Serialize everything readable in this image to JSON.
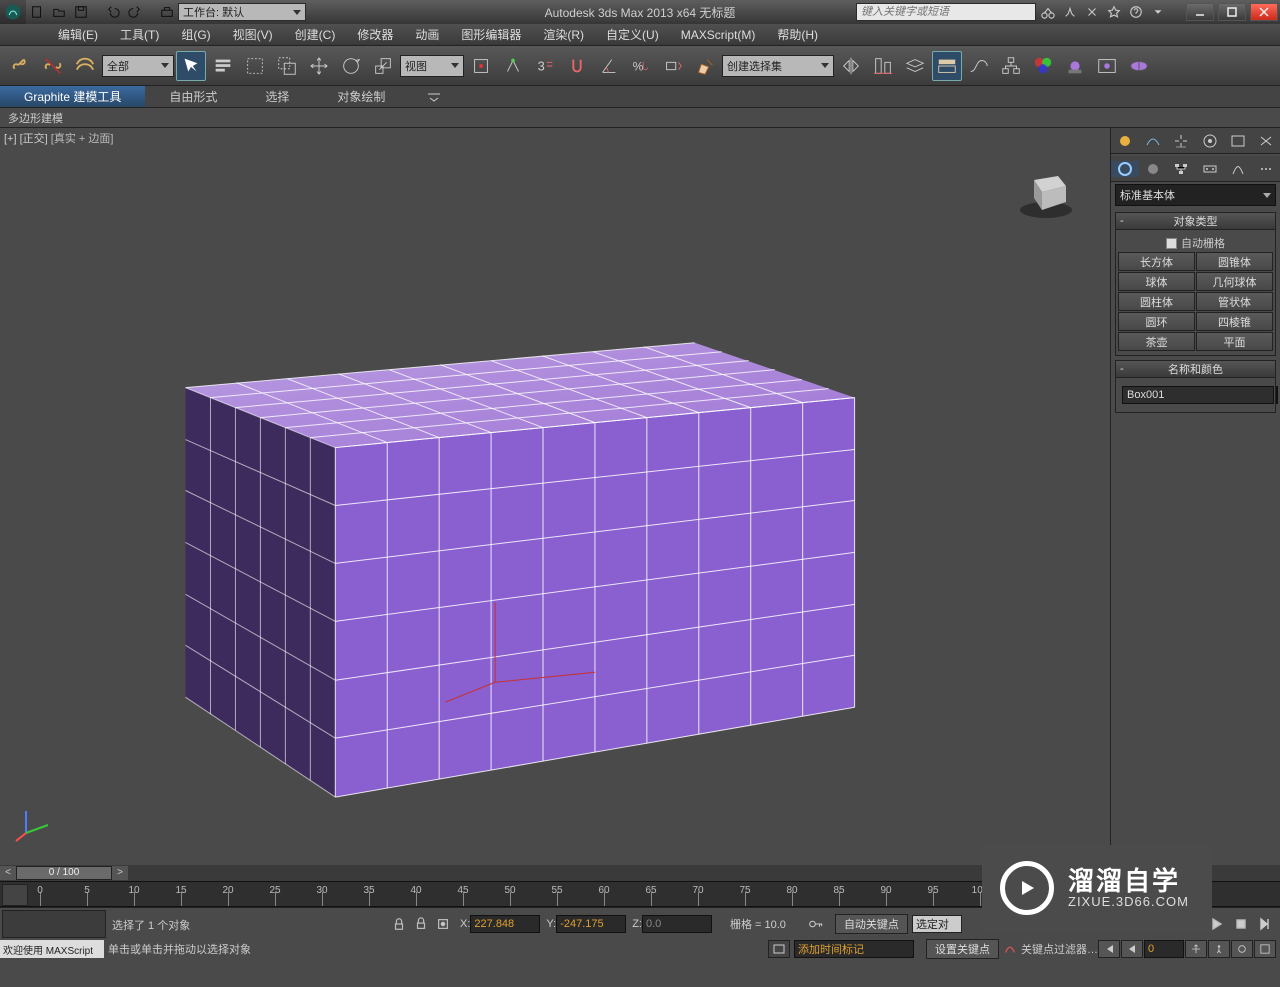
{
  "app": {
    "title": "Autodesk 3ds Max  2013 x64     无标题",
    "search_placeholder": "键入关键字或短语",
    "workspace": "工作台: 默认"
  },
  "menus": [
    "编辑(E)",
    "工具(T)",
    "组(G)",
    "视图(V)",
    "创建(C)",
    "修改器",
    "动画",
    "图形编辑器",
    "渲染(R)",
    "自定义(U)",
    "MAXScript(M)",
    "帮助(H)"
  ],
  "maintoolbar": {
    "filter": "全部",
    "view_combo": "视图",
    "named_set": "创建选择集"
  },
  "ribbon": {
    "tabs": [
      "Graphite 建模工具",
      "自由形式",
      "选择",
      "对象绘制"
    ],
    "subtab": "多边形建模"
  },
  "viewport": {
    "label_bracket1": "[+]",
    "label_bracket2": "[正交]",
    "label_bracket3": "[真实 + 边面]"
  },
  "cmdpanel": {
    "category": "标准基本体",
    "rollout_objecttype": "对象类型",
    "autogrid": "自动栅格",
    "prims": [
      "长方体",
      "圆锥体",
      "球体",
      "几何球体",
      "圆柱体",
      "管状体",
      "圆环",
      "四棱锥",
      "茶壶",
      "平面"
    ],
    "rollout_namecolor": "名称和颜色",
    "object_name": "Box001",
    "swatch_color": "#8a5fcf"
  },
  "time": {
    "slider": "0 / 100",
    "ticks": [
      0,
      5,
      10,
      15,
      20,
      25,
      30,
      35,
      40,
      45,
      50,
      55,
      60,
      65,
      70,
      75,
      80,
      85,
      90,
      95,
      100
    ]
  },
  "status": {
    "sel_line": "选择了 1 个对象",
    "hint_line": "单击或单击并拖动以选择对象",
    "x": "227.848",
    "y": "-247.175",
    "z": "0.0",
    "grid": "栅格 = 10.0",
    "autokey": "自动关键点",
    "selkey": "选定对",
    "setkey": "设置关键点",
    "keyfilter": "关键点过滤器…",
    "add_time_tag": "添加时间标记",
    "maxscript_welcome": "欢迎使用 MAXScript",
    "frame": "0"
  },
  "watermark": {
    "t1": "溜溜自学",
    "t2": "ZIXUE.3D66.COM"
  }
}
